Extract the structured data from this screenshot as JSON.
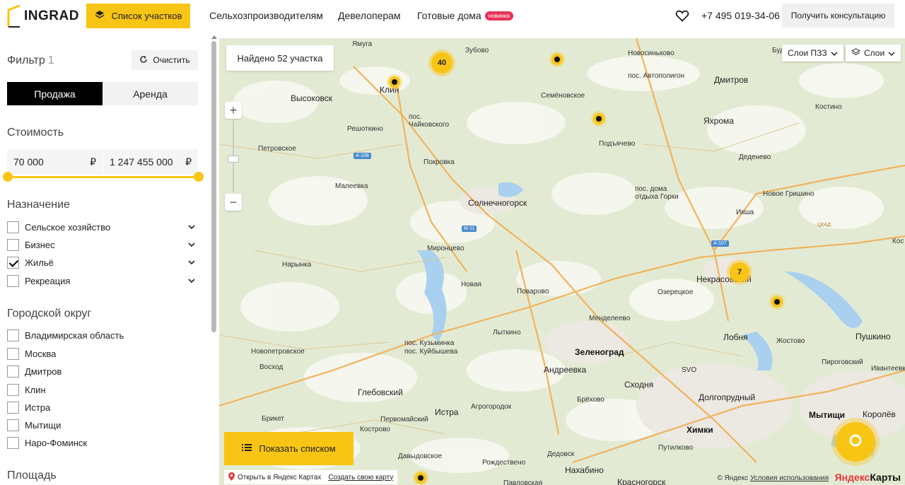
{
  "header": {
    "logo": "INGRAD",
    "plots_button": "Список участков",
    "nav": [
      {
        "label": "Сельхозпроизводителям"
      },
      {
        "label": "Девелоперам"
      },
      {
        "label": "Готовые дома",
        "badge": "новинка"
      }
    ],
    "phone": "+7 495 019-34-06",
    "consult_button": "Получить консультацию"
  },
  "filter": {
    "title": "Фильтр",
    "count": "1",
    "clear": "Очистить",
    "tabs": [
      "Продажа",
      "Аренда"
    ],
    "active_tab": "Продажа",
    "cost": {
      "title": "Стоимость",
      "min": "70 000",
      "max": "1 247 455 000",
      "currency": "₽"
    },
    "purpose": {
      "title": "Назначение",
      "items": [
        {
          "label": "Сельское хозяйство",
          "checked": false
        },
        {
          "label": "Бизнес",
          "checked": false
        },
        {
          "label": "Жильё",
          "checked": true
        },
        {
          "label": "Рекреация",
          "checked": false
        }
      ]
    },
    "district": {
      "title": "Городской округ",
      "items": [
        {
          "label": "Владимирская область"
        },
        {
          "label": "Москва"
        },
        {
          "label": "Дмитров"
        },
        {
          "label": "Клин"
        },
        {
          "label": "Истра"
        },
        {
          "label": "Мытищи"
        },
        {
          "label": "Наро-Фоминск"
        }
      ]
    },
    "area_title": "Площадь"
  },
  "map": {
    "found": "Найдено 52 участка",
    "layers_pzz": "Слои ПЗЗ",
    "layers": "Слои",
    "clusters": [
      "40",
      "7"
    ],
    "show_list": "Показать списком",
    "open_yandex": "Открыть в Яндекс Картах",
    "create_map": "Создать свою карту",
    "copyright": "© Яндекс",
    "terms": "Условия использования",
    "brand_red": "Яндекс",
    "brand_black": "Карты",
    "places": [
      {
        "name": "Ямуга"
      },
      {
        "name": "Зубово"
      },
      {
        "name": "Новосинько­во"
      },
      {
        "name": "пос. Автополигон"
      },
      {
        "name": "Дмитров"
      },
      {
        "name": "Клин"
      },
      {
        "name": "Высоковск"
      },
      {
        "name": "Семёновское"
      },
      {
        "name": "пос. Чайковского"
      },
      {
        "name": "Решоткино"
      },
      {
        "name": "Подъячево"
      },
      {
        "name": "Яхрома"
      },
      {
        "name": "Костино"
      },
      {
        "name": "Петровское"
      },
      {
        "name": "Покровка"
      },
      {
        "name": "Деденево"
      },
      {
        "name": "Малеевка"
      },
      {
        "name": "Солнечногорск"
      },
      {
        "name": "пос. дома отдыха Горки"
      },
      {
        "name": "Новое Гришино"
      },
      {
        "name": "Икша"
      },
      {
        "name": "Миронцево"
      },
      {
        "name": "Нарынка"
      },
      {
        "name": "Некрасовский"
      },
      {
        "name": "Новая"
      },
      {
        "name": "Поварово"
      },
      {
        "name": "Озерецкое"
      },
      {
        "name": "Лыткино"
      },
      {
        "name": "Менделеево"
      },
      {
        "name": "Лобня"
      },
      {
        "name": "Пушкино"
      },
      {
        "name": "пос. Кузьминка"
      },
      {
        "name": "Жостово"
      },
      {
        "name": "Новопетровское"
      },
      {
        "name": "пос. Куйбышева"
      },
      {
        "name": "Зеленоград"
      },
      {
        "name": "Восход"
      },
      {
        "name": "Андреевка"
      },
      {
        "name": "SVO"
      },
      {
        "name": "Пироговский"
      },
      {
        "name": "Ивантеевка"
      },
      {
        "name": "Глебовский"
      },
      {
        "name": "Сходня"
      },
      {
        "name": "Долгопрудный"
      },
      {
        "name": "Истра"
      },
      {
        "name": "Агрогородок"
      },
      {
        "name": "Брёхово"
      },
      {
        "name": "Брикет"
      },
      {
        "name": "Первомайский"
      },
      {
        "name": "Мытищи"
      },
      {
        "name": "Королёв"
      },
      {
        "name": "Кострово"
      },
      {
        "name": "Химки"
      },
      {
        "name": "Путилково"
      },
      {
        "name": "Давыдовское"
      },
      {
        "name": "Рождествено"
      },
      {
        "name": "Дедовск"
      },
      {
        "name": "Нахабино"
      },
      {
        "name": "Красногорск"
      },
      {
        "name": "Павловская"
      },
      {
        "name": "Будён"
      },
      {
        "name": "Кос"
      }
    ],
    "roads": [
      "А-108",
      "М-11",
      "А-107",
      "ЦКАД"
    ]
  }
}
